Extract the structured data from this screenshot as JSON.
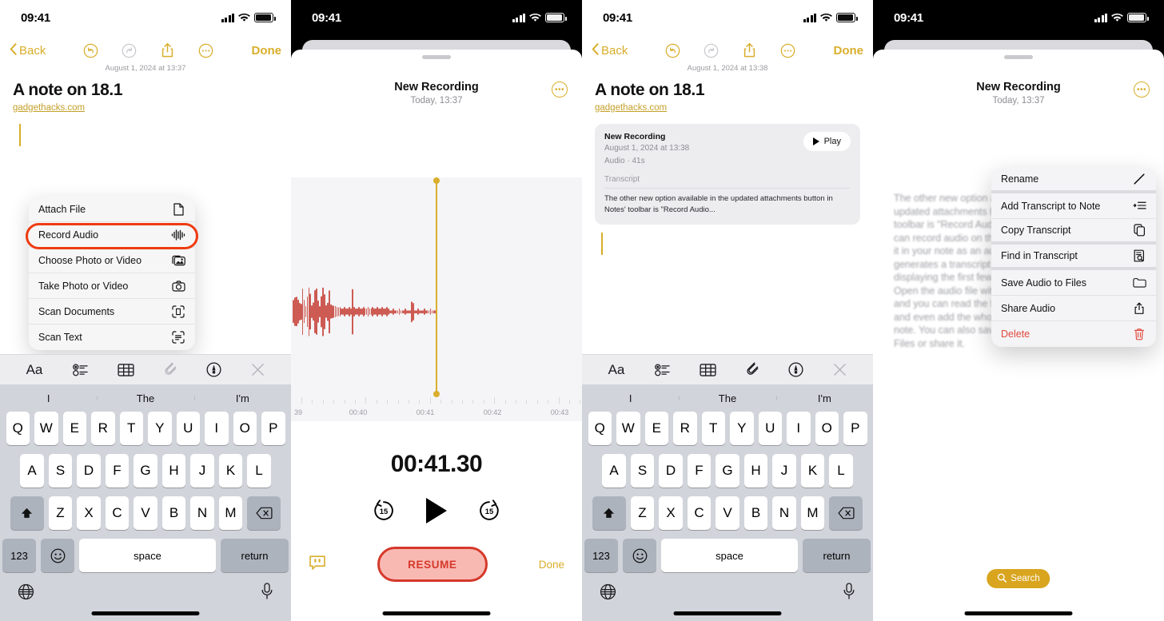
{
  "accent": {
    "gold": "#D9AE2B",
    "gold_dim": "#C9C9CE",
    "red": "#D5392B",
    "highlight_ring": "#EE3B11",
    "waveform": "#CD5B53"
  },
  "status_bar": {
    "time": "09:41"
  },
  "panel1": {
    "toolbar": {
      "back": "Back",
      "done": "Done",
      "undo_icon": "undo-icon",
      "redo_icon": "redo-icon",
      "share_icon": "share-icon",
      "more_icon": "more-ellipsis-icon"
    },
    "note": {
      "date": "August 1, 2024 at 13:37",
      "title": "A note on 18.1",
      "link": "gadgethacks.com"
    },
    "attach_menu": {
      "items": [
        {
          "label": "Attach File",
          "icon": "document-icon"
        },
        {
          "label": "Record Audio",
          "icon": "waveform-icon",
          "highlighted": true
        },
        {
          "label": "Choose Photo or Video",
          "icon": "photo-library-icon"
        },
        {
          "label": "Take Photo or Video",
          "icon": "camera-icon"
        },
        {
          "label": "Scan Documents",
          "icon": "scan-document-icon"
        },
        {
          "label": "Scan Text",
          "icon": "scan-text-icon"
        }
      ]
    },
    "format_bar": [
      {
        "label": "Aa",
        "icon": "text-format-icon",
        "dim": false
      },
      {
        "label": "",
        "icon": "checklist-icon",
        "dim": false
      },
      {
        "label": "",
        "icon": "table-icon",
        "dim": false
      },
      {
        "label": "",
        "icon": "paperclip-icon",
        "dim": true
      },
      {
        "label": "",
        "icon": "markup-pen-icon",
        "dim": false
      },
      {
        "label": "",
        "icon": "close-icon",
        "dim": true
      }
    ]
  },
  "panel2": {
    "recording": {
      "title": "New Recording",
      "subtitle": "Today, 13:37",
      "more_icon": "more-ellipsis-circle-icon"
    },
    "timeline": {
      "labels": [
        "39",
        "00:40",
        "00:41",
        "00:42",
        "00:43"
      ],
      "playhead_label": "00:41"
    },
    "elapsed": "00:41.30",
    "controls": {
      "back15": "15",
      "forward15": "15",
      "play_icon": "play-icon",
      "transcript_icon": "transcript-quote-icon",
      "resume": "RESUME",
      "done": "Done"
    }
  },
  "panel3": {
    "toolbar": {
      "back": "Back",
      "done": "Done"
    },
    "note": {
      "date": "August 1, 2024 at 13:38",
      "title": "A note on 18.1",
      "link": "gadgethacks.com"
    },
    "audio_card": {
      "name": "New Recording",
      "date": "August 1, 2024 at 13:38",
      "meta": "Audio · 41s",
      "play_label": "Play",
      "transcript_label": "Transcript",
      "transcript_text": "The other new option available in the updated attachments button in Notes' toolbar is \"Record Audio..."
    }
  },
  "panel4": {
    "recording": {
      "title": "New Recording",
      "subtitle": "Today, 13:37"
    },
    "body_text": "The other new option available in the updated attachments button in Notes' toolbar is \"Record Audio.\" With it, you can record audio on the spot and embed it in your note as an audio file. Notes generates a transcript of the audio file, displaying the first few lines as a preview. Open the audio file with the play button, and you can read the transcript, search it, and even add the whole thing to your note. You can also save the audio to Files or share it.",
    "menu": {
      "items": [
        {
          "label": "Rename",
          "icon": "pencil-icon",
          "separator_after": true
        },
        {
          "label": "Add Transcript to Note",
          "icon": "add-transcript-icon"
        },
        {
          "label": "Copy Transcript",
          "icon": "copy-icon",
          "separator_after": true
        },
        {
          "label": "Find in Transcript",
          "icon": "find-document-icon",
          "separator_after": true
        },
        {
          "label": "Save Audio to Files",
          "icon": "folder-icon"
        },
        {
          "label": "Share Audio",
          "icon": "share-icon"
        },
        {
          "label": "Delete",
          "icon": "trash-icon",
          "danger": true
        }
      ]
    },
    "search_pill": {
      "label": "Search",
      "icon": "search-icon"
    }
  },
  "keyboard": {
    "suggestions": [
      "I",
      "The",
      "I'm"
    ],
    "row1": [
      "Q",
      "W",
      "E",
      "R",
      "T",
      "Y",
      "U",
      "I",
      "O",
      "P"
    ],
    "row2": [
      "A",
      "S",
      "D",
      "F",
      "G",
      "H",
      "J",
      "K",
      "L"
    ],
    "row3": [
      "Z",
      "X",
      "C",
      "V",
      "B",
      "N",
      "M"
    ],
    "shift_icon": "shift-up-icon",
    "backspace_icon": "backspace-icon",
    "numeric": "123",
    "emoji_icon": "emoji-smile-icon",
    "space": "space",
    "return": "return",
    "globe_icon": "globe-icon",
    "mic_icon": "microphone-icon"
  }
}
